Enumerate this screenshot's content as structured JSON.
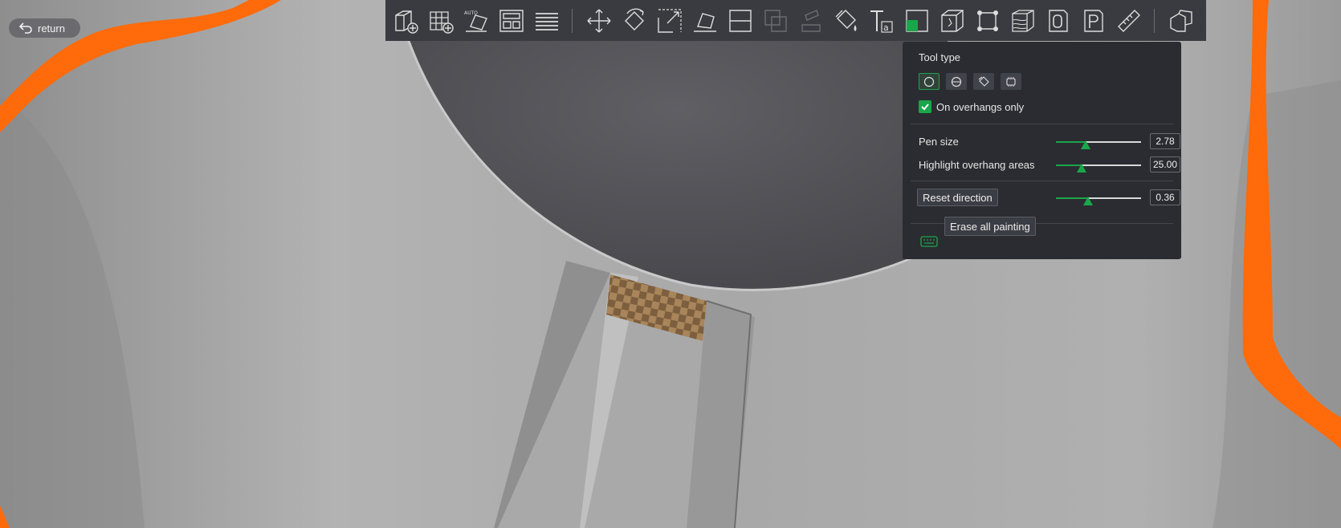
{
  "return_button": {
    "label": "return",
    "icon": "undo-arrow-icon"
  },
  "toolbar": {
    "tools": [
      {
        "name": "add-object",
        "icon": "cube-plus-icon"
      },
      {
        "name": "add-plate",
        "icon": "grid-plus-icon"
      },
      {
        "name": "auto-orient",
        "icon": "auto-orient-icon"
      },
      {
        "name": "arrange",
        "icon": "arrange-icon"
      },
      {
        "name": "split-layers",
        "icon": "layers-icon"
      },
      {
        "name": "move",
        "icon": "move-arrows-icon"
      },
      {
        "name": "rotate",
        "icon": "rotate-icon"
      },
      {
        "name": "scale",
        "icon": "scale-icon"
      },
      {
        "name": "lay-on-face",
        "icon": "lay-on-face-icon"
      },
      {
        "name": "cut",
        "icon": "cut-icon"
      },
      {
        "name": "boolean",
        "icon": "boolean-icon"
      },
      {
        "name": "support-painting",
        "icon": "support-paint-icon"
      },
      {
        "name": "color-painting",
        "icon": "paint-bucket-icon"
      },
      {
        "name": "text",
        "icon": "text-icon"
      },
      {
        "name": "seam-painting",
        "icon": "seam-icon"
      },
      {
        "name": "fix-model",
        "icon": "fix-model-icon"
      },
      {
        "name": "measure-bounds",
        "icon": "bounds-icon"
      },
      {
        "name": "variable-layer-height",
        "icon": "variable-layer-icon"
      },
      {
        "name": "object-info",
        "icon": "object-0-icon"
      },
      {
        "name": "plate-info",
        "icon": "plate-p-icon"
      },
      {
        "name": "measure",
        "icon": "ruler-icon"
      },
      {
        "name": "assemble",
        "icon": "assemble-icon"
      }
    ]
  },
  "panel": {
    "title": "Tool type",
    "tool_types": [
      {
        "name": "circle",
        "icon": "circle-brush-icon",
        "active": true
      },
      {
        "name": "sphere",
        "icon": "sphere-brush-icon",
        "active": false
      },
      {
        "name": "fill",
        "icon": "fill-bucket-icon",
        "active": false
      },
      {
        "name": "gap-fill",
        "icon": "gap-fill-icon",
        "active": false
      }
    ],
    "overhangs_only": {
      "label": "On overhangs only",
      "checked": true
    },
    "pen_size": {
      "label": "Pen size",
      "value": "2.78",
      "level": 0.35
    },
    "highlight": {
      "label": "Highlight overhang areas",
      "value": "25.00",
      "level": 0.3
    },
    "direction": {
      "label": "Reset direction",
      "value": "0.36",
      "level": 0.38
    },
    "erase_label": "Erase all painting",
    "keyboard_icon": "keyboard-icon"
  },
  "colors": {
    "accent": "#1aa64a",
    "orange": "#ff6a0a",
    "panel_bg": "#2b2c31",
    "toolbar_bg": "#3a3b40"
  }
}
